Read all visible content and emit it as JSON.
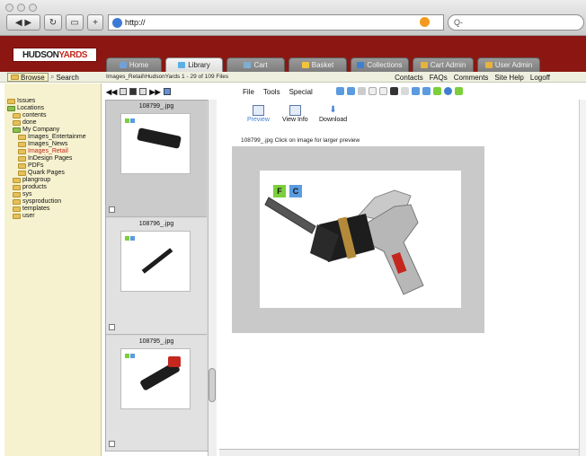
{
  "browser": {
    "url": "http://",
    "search_placeholder": "Q-"
  },
  "brand": {
    "logo_prefix": "HUDSON",
    "logo_suffix": "YARDS"
  },
  "tabs": [
    {
      "label": "Home",
      "icon": "home-icon",
      "color": "#6fa1d8"
    },
    {
      "label": "Library",
      "icon": "library-icon",
      "color": "#5bb0e3"
    },
    {
      "label": "Cart",
      "icon": "cart-icon",
      "color": "#7faed3"
    },
    {
      "label": "Basket",
      "icon": "basket-icon",
      "color": "#f2c43a"
    },
    {
      "label": "Collections",
      "icon": "collections-icon",
      "color": "#3f7fd0"
    },
    {
      "label": "Cart Admin",
      "icon": "cart-admin-icon",
      "color": "#e6b33c"
    },
    {
      "label": "User Admin",
      "icon": "user-admin-icon",
      "color": "#e6b33c"
    }
  ],
  "toolbar": {
    "browse": "Browse",
    "search": "Search"
  },
  "top_links": [
    "Contacts",
    "FAQs",
    "Comments",
    "Site Help",
    "Logoff"
  ],
  "path_text": "Images_Retail\\HudsonYards   1 - 29 of 109 Files",
  "menus": [
    "File",
    "Tools",
    "Special"
  ],
  "tree": [
    {
      "label": "Issues",
      "indent": 0,
      "type": "folder"
    },
    {
      "label": "Locations",
      "indent": 0,
      "type": "green"
    },
    {
      "label": "contents",
      "indent": 1,
      "type": "folder"
    },
    {
      "label": "done",
      "indent": 1,
      "type": "folder"
    },
    {
      "label": "My Company",
      "indent": 1,
      "type": "green"
    },
    {
      "label": "Images_Entertainme",
      "indent": 2,
      "type": "folder"
    },
    {
      "label": "Images_News",
      "indent": 2,
      "type": "folder"
    },
    {
      "label": "Images_Retail",
      "indent": 2,
      "type": "folder",
      "selected": true
    },
    {
      "label": "InDesign Pages",
      "indent": 2,
      "type": "folder"
    },
    {
      "label": "PDFs",
      "indent": 2,
      "type": "folder"
    },
    {
      "label": "Quark Pages",
      "indent": 2,
      "type": "folder"
    },
    {
      "label": "plangroup",
      "indent": 1,
      "type": "folder"
    },
    {
      "label": "products",
      "indent": 1,
      "type": "folder"
    },
    {
      "label": "sys",
      "indent": 1,
      "type": "folder"
    },
    {
      "label": "sysproduction",
      "indent": 1,
      "type": "folder"
    },
    {
      "label": "templates",
      "indent": 1,
      "type": "folder"
    },
    {
      "label": "user",
      "indent": 1,
      "type": "folder"
    }
  ],
  "thumbnails": [
    {
      "name": "108799_.jpg",
      "selected": true
    },
    {
      "name": "108796_.jpg",
      "selected": false
    },
    {
      "name": "108795_.jpg",
      "selected": false
    }
  ],
  "viewer": {
    "buttons": [
      "Preview",
      "View Info",
      "Download"
    ],
    "caption": "108799_.jpg  Click on image for larger preview",
    "badges": [
      "F",
      "C"
    ]
  },
  "colors": {
    "brand_red": "#8c1712",
    "badge_f": "#7ccf3a",
    "badge_c": "#5b9be0"
  }
}
